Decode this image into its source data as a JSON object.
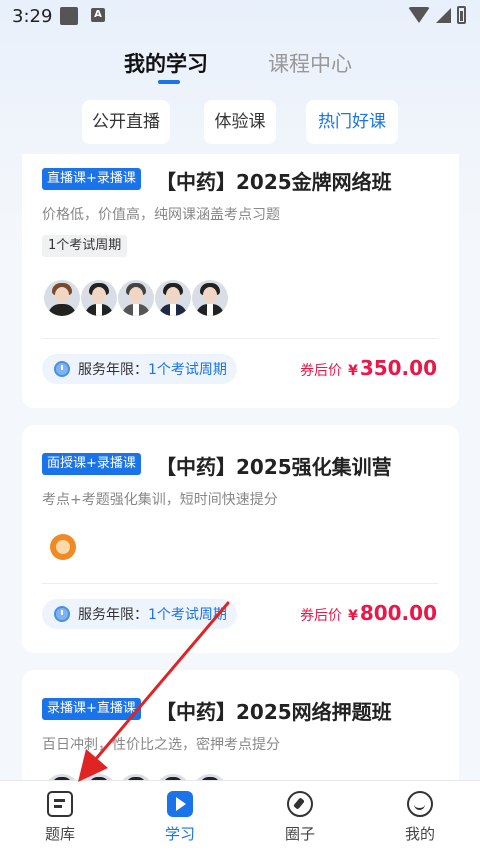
{
  "status_bar": {
    "time": "3:29",
    "notif_letter": "A"
  },
  "header": {
    "tabs": [
      {
        "label": "我的学习",
        "active": true
      },
      {
        "label": "课程中心",
        "active": false
      }
    ]
  },
  "filters": [
    {
      "label": "公开直播"
    },
    {
      "label": "体验课"
    },
    {
      "label": "热门好课",
      "active": true
    }
  ],
  "courses": [
    {
      "badge": "直播课+录播课",
      "title": "【中药】2025金牌网络班",
      "desc": "价格低，价值高，纯网课涵盖考点习题",
      "tag": "1个考试周期",
      "service_label": "服务年限：",
      "service_value": "1个考试周期",
      "price_label": "券后价",
      "currency": "¥",
      "price": "350.00"
    },
    {
      "badge": "面授课+录播课",
      "title": "【中药】2025强化集训营",
      "desc": "考点+考题强化集训，短时间快速提分",
      "service_label": "服务年限：",
      "service_value": "1个考试周期",
      "price_label": "券后价",
      "currency": "¥",
      "price": "800.00"
    },
    {
      "badge": "录播课+直播课",
      "title": "【中药】2025网络押题班",
      "desc": "百日冲刺，性价比之选，密押考点提分"
    }
  ],
  "bottom_nav": [
    {
      "label": "题库",
      "icon": "question-bank-icon"
    },
    {
      "label": "学习",
      "icon": "study-play-icon",
      "active": true
    },
    {
      "label": "圈子",
      "icon": "compass-icon"
    },
    {
      "label": "我的",
      "icon": "smile-icon"
    }
  ],
  "colors": {
    "accent": "#1a73e8",
    "price": "#e8194a",
    "annotation_arrow": "#e02424"
  }
}
